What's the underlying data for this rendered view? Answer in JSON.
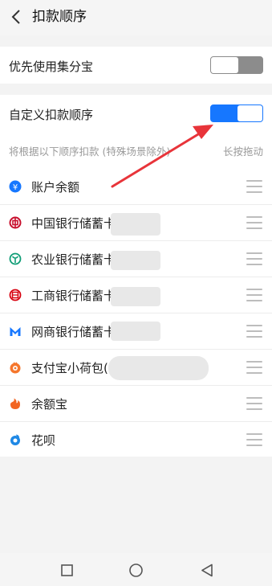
{
  "header": {
    "title": "扣款顺序"
  },
  "settings": {
    "prefer_jifenbao": {
      "label": "优先使用集分宝",
      "state": "off"
    },
    "custom_order": {
      "label": "自定义扣款顺序",
      "state": "on"
    }
  },
  "hint": {
    "left": "将根据以下顺序扣款 (特殊场景除外)",
    "right": "长按拖动"
  },
  "methods": [
    {
      "label": "账户余额",
      "icon": "balance-icon",
      "color": "#1677ff"
    },
    {
      "label": "中国银行储蓄卡",
      "icon": "bank-of-china-icon",
      "color": "#c8102e"
    },
    {
      "label": "农业银行储蓄卡",
      "icon": "agricultural-bank-icon",
      "color": "#0f9d76"
    },
    {
      "label": "工商银行储蓄卡",
      "icon": "icbc-icon",
      "color": "#d7000f"
    },
    {
      "label": "网商银行储蓄卡",
      "icon": "mybank-icon",
      "color": "#1677ff"
    },
    {
      "label": "支付宝小荷包(",
      "icon": "alipay-pouch-icon",
      "color": "#f5762c"
    },
    {
      "label": "余额宝",
      "icon": "yuebao-icon",
      "color": "#f26522"
    },
    {
      "label": "花呗",
      "icon": "huabei-icon",
      "color": "#1e88e5"
    }
  ]
}
